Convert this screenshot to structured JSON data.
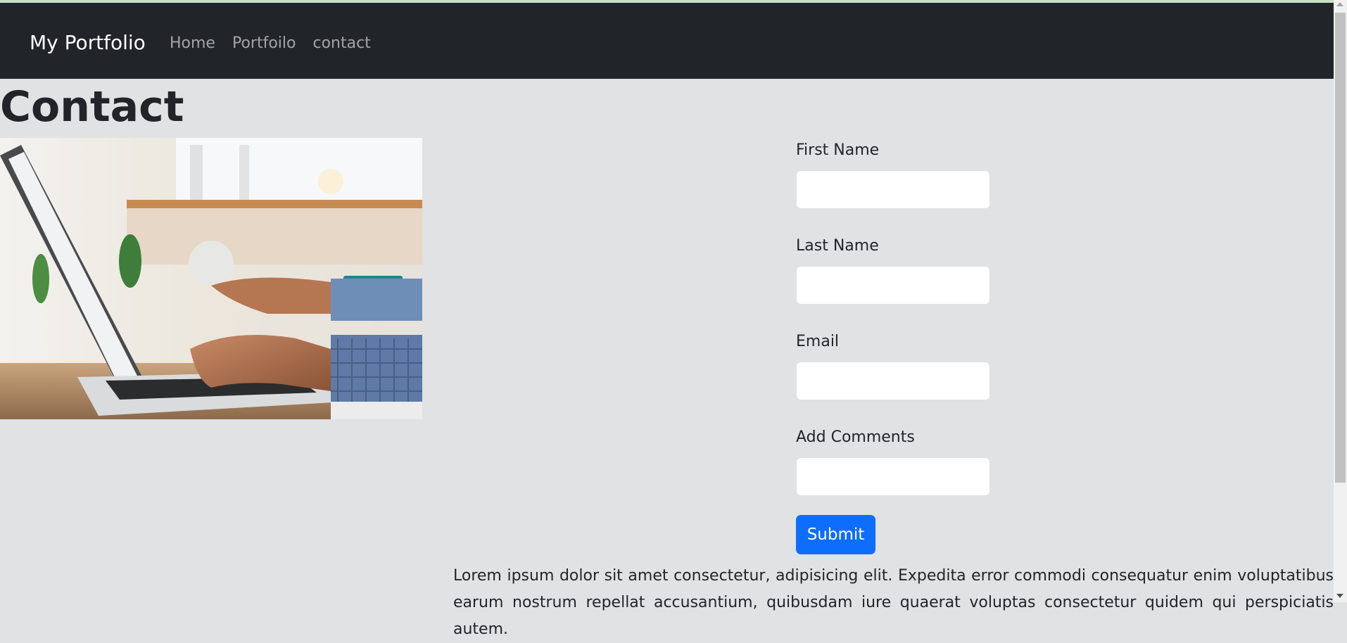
{
  "navbar": {
    "brand": "My Portfolio",
    "links": [
      "Home",
      "Portfoilo",
      "contact"
    ]
  },
  "page": {
    "title": "Contact"
  },
  "image": {
    "icon": "laptop-typing-photo"
  },
  "form": {
    "fields": [
      {
        "label": "First Name",
        "value": ""
      },
      {
        "label": "Last Name",
        "value": ""
      },
      {
        "label": "Email",
        "value": ""
      },
      {
        "label": "Add Comments",
        "value": ""
      }
    ],
    "submit_label": "Submit"
  },
  "body_text": "Lorem ipsum dolor sit amet consectetur, adipisicing elit. Expedita error commodi consequatur enim voluptatibus earum nostrum repellat accusantium, quibusdam iure quaerat voluptas consectetur quidem qui perspiciatis autem.",
  "colors": {
    "navbar": "#212529",
    "page_background": "#e1e2e4",
    "primary_button": "#0d6efd"
  }
}
